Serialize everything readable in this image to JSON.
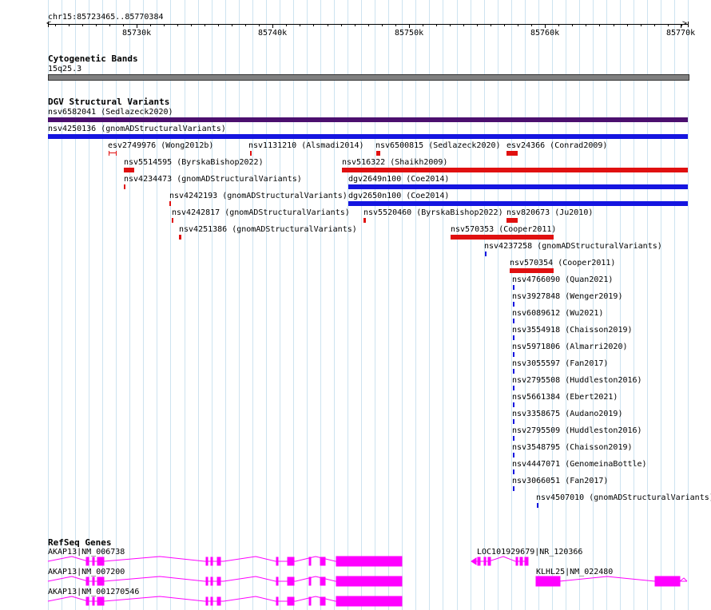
{
  "locus": "chr15:85723465..85770384",
  "ruler": {
    "ticks": [
      "85730k",
      "85740k",
      "85750k",
      "85760k",
      "85770k"
    ]
  },
  "tracks": {
    "cytoband": {
      "title": "Cytogenetic Bands",
      "band": "15q25.3",
      "color": "#7f7f7f"
    },
    "dgv": {
      "title": "DGV Structural Variants",
      "features": [
        {
          "label": "nsv6582041 (Sedlazeck2020)",
          "color": "#4b0f6e"
        },
        {
          "label": "nsv4250136 (gnomADStructuralVariants)",
          "color": "#1515e0"
        },
        {
          "label": "esv2749976 (Wong2012b)",
          "color": "#e01010"
        },
        {
          "label": "nsv1131210 (Alsmadi2014)",
          "color": "#e01010"
        },
        {
          "label": "nsv6500815 (Sedlazeck2020)",
          "color": "#e01010"
        },
        {
          "label": "esv24366 (Conrad2009)",
          "color": "#e01010"
        },
        {
          "label": "nsv5514595 (ByrskaBishop2022)",
          "color": "#e01010"
        },
        {
          "label": "nsv516322 (Shaikh2009)",
          "color": "#e01010"
        },
        {
          "label": "nsv4234473 (gnomADStructuralVariants)",
          "color": "#e01010"
        },
        {
          "label": "dgv2649n100 (Coe2014)",
          "color": "#1515e0"
        },
        {
          "label": "nsv4242193 (gnomADStructuralVariants)",
          "color": "#e01010"
        },
        {
          "label": "dgv2650n100 (Coe2014)",
          "color": "#1515e0"
        },
        {
          "label": "nsv4242817 (gnomADStructuralVariants)",
          "color": "#e01010"
        },
        {
          "label": "nsv5520460 (ByrskaBishop2022)",
          "color": "#e01010"
        },
        {
          "label": "nsv820673 (Ju2010)",
          "color": "#e01010"
        },
        {
          "label": "nsv4251386 (gnomADStructuralVariants)",
          "color": "#e01010"
        },
        {
          "label": "nsv570353 (Cooper2011)",
          "color": "#e01010"
        },
        {
          "label": "nsv4237258 (gnomADStructuralVariants)",
          "color": "#1515e0"
        },
        {
          "label": "nsv570354 (Cooper2011)",
          "color": "#e01010"
        },
        {
          "label": "nsv4766090 (Quan2021)",
          "color": "#1515e0"
        },
        {
          "label": "nsv3927848 (Wenger2019)",
          "color": "#1515e0"
        },
        {
          "label": "nsv6089612 (Wu2021)",
          "color": "#1515e0"
        },
        {
          "label": "nsv3554918 (Chaisson2019)",
          "color": "#1515e0"
        },
        {
          "label": "nsv5971806 (Almarri2020)",
          "color": "#1515e0"
        },
        {
          "label": "nsv3055597 (Fan2017)",
          "color": "#1515e0"
        },
        {
          "label": "nsv2795508 (Huddleston2016)",
          "color": "#1515e0"
        },
        {
          "label": "nsv5661384 (Ebert2021)",
          "color": "#1515e0"
        },
        {
          "label": "nsv3358675 (Audano2019)",
          "color": "#1515e0"
        },
        {
          "label": "nsv2795509 (Huddleston2016)",
          "color": "#1515e0"
        },
        {
          "label": "nsv3548795 (Chaisson2019)",
          "color": "#1515e0"
        },
        {
          "label": "nsv4447071 (GenomeinaBottle)",
          "color": "#1515e0"
        },
        {
          "label": "nsv3066051 (Fan2017)",
          "color": "#1515e0"
        },
        {
          "label": "nsv4507010 (gnomADStructuralVariants)",
          "color": "#1515e0"
        }
      ]
    },
    "refseq": {
      "title": "RefSeq Genes",
      "color": "#ff00ff",
      "genes": [
        {
          "label": "AKAP13|NM_006738"
        },
        {
          "label": "AKAP13|NM_007200"
        },
        {
          "label": "AKAP13|NM_001270546"
        },
        {
          "label": "LOC101929679|NR_120366"
        },
        {
          "label": "KLHL25|NM_022480"
        }
      ]
    }
  }
}
